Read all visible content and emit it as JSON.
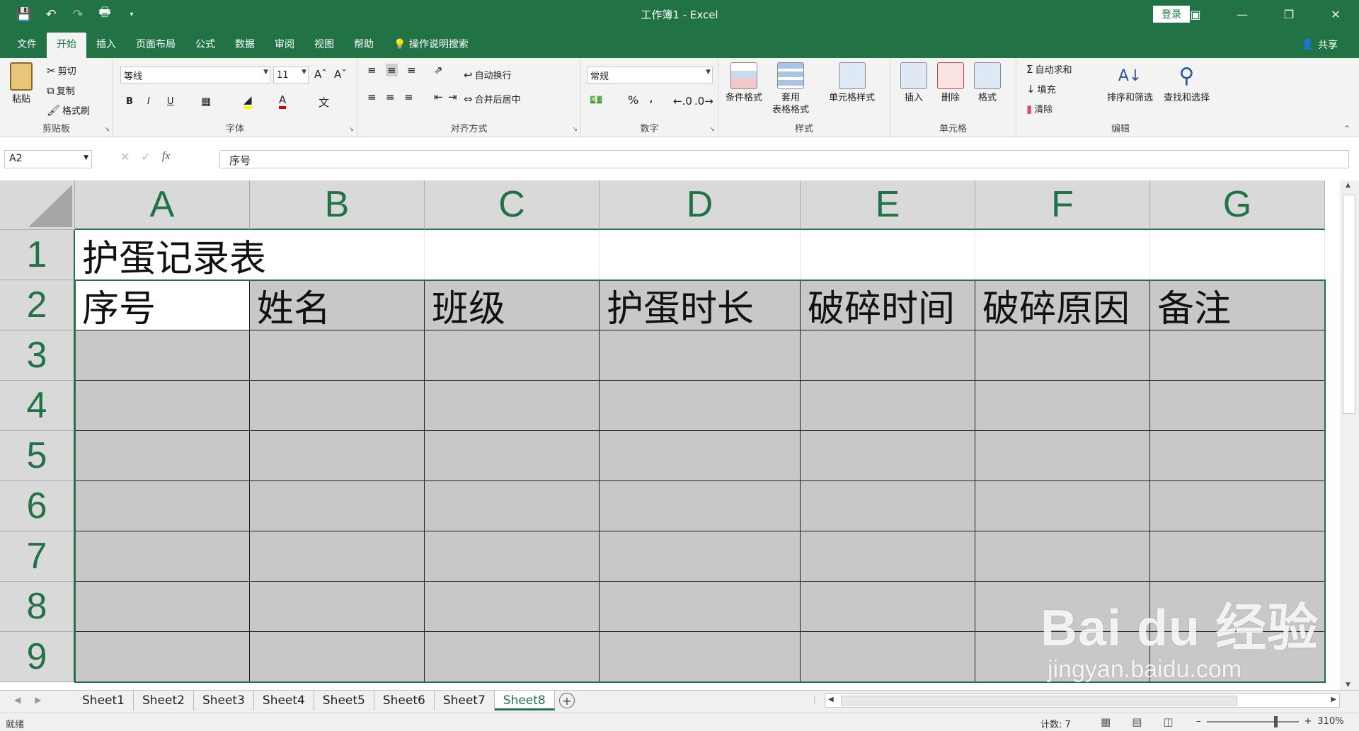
{
  "title_bar": {
    "title": "工作簿1  -  Excel",
    "login": "登录"
  },
  "tabs": [
    {
      "label": "文件"
    },
    {
      "label": "开始"
    },
    {
      "label": "插入"
    },
    {
      "label": "页面布局"
    },
    {
      "label": "公式"
    },
    {
      "label": "数据"
    },
    {
      "label": "审阅"
    },
    {
      "label": "视图"
    },
    {
      "label": "帮助"
    },
    {
      "label": "操作说明搜索"
    }
  ],
  "share": "共享",
  "ribbon": {
    "clipboard": {
      "label": "剪贴板",
      "paste": "粘贴",
      "cut": "剪切",
      "copy": "复制",
      "format_painter": "格式刷"
    },
    "font": {
      "label": "字体",
      "font_name": "等线",
      "font_size": "11",
      "bold": "B",
      "italic": "I",
      "underline": "U"
    },
    "alignment": {
      "label": "对齐方式",
      "wrap": "自动换行",
      "merge": "合并后居中"
    },
    "number": {
      "label": "数字",
      "format": "常规",
      "percent": "%",
      "comma": ","
    },
    "styles": {
      "label": "样式",
      "conditional": "条件格式",
      "table_1": "套用",
      "table_2": "表格格式",
      "cell_styles": "单元格样式"
    },
    "cells": {
      "label": "单元格",
      "insert": "插入",
      "delete": "删除",
      "format": "格式"
    },
    "editing": {
      "label": "编辑",
      "autosum": "自动求和",
      "fill": "填充",
      "clear": "清除",
      "sort": "排序和筛选",
      "find": "查找和选择"
    }
  },
  "formula_bar": {
    "name_box": "A2",
    "fx": "fx",
    "content": "序号"
  },
  "grid": {
    "columns": [
      "A",
      "B",
      "C",
      "D",
      "E",
      "F",
      "G"
    ],
    "rows": [
      "1",
      "2",
      "3",
      "4",
      "5",
      "6",
      "7",
      "8",
      "9"
    ],
    "title_cell": "护蛋记录表",
    "headers": [
      "序号",
      "姓名",
      "班级",
      "护蛋时长",
      "破碎时间",
      "破碎原因",
      "备注"
    ]
  },
  "sheets": [
    "Sheet1",
    "Sheet2",
    "Sheet3",
    "Sheet4",
    "Sheet5",
    "Sheet6",
    "Sheet7",
    "Sheet8"
  ],
  "active_sheet": "Sheet8",
  "status": {
    "ready": "就绪",
    "count": "计数: 7",
    "zoom": "310%"
  },
  "watermark": {
    "main": "Bai du 经验",
    "sub": "jingyan.baidu.com"
  },
  "colors": {
    "accent": "#217346",
    "cell_fill": "#c8c8c8"
  }
}
